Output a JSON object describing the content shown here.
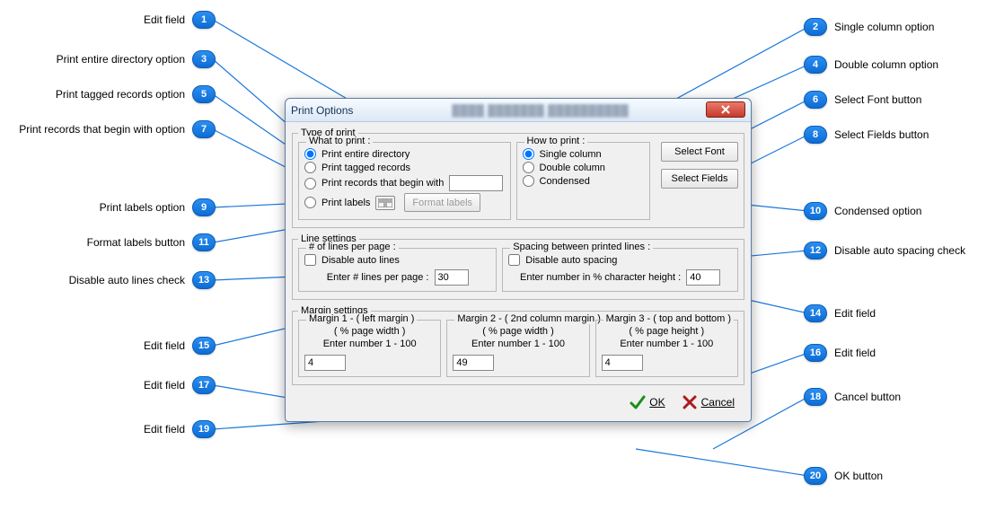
{
  "dialog": {
    "title": "Print Options",
    "blurred_subtitle": "████ ███████ ██████████",
    "type_of_print": {
      "legend": "Type of print",
      "what": {
        "legend": "What to print :",
        "r1": "Print entire directory",
        "r2": "Print tagged records",
        "r3": "Print records that begin with",
        "r3_value": "",
        "r4": "Print labels",
        "format_labels": "Format labels"
      },
      "how": {
        "legend": "How to print :",
        "r1": "Single column",
        "r2": "Double column",
        "r3": "Condensed"
      },
      "buttons": {
        "select_font": "Select Font",
        "select_fields": "Select Fields"
      }
    },
    "line_settings": {
      "legend": "Line settings",
      "lines_per_page": {
        "legend": "# of lines per page :",
        "disable": "Disable auto lines",
        "enter_label": "Enter # lines per page :",
        "value": "30"
      },
      "spacing": {
        "legend": "Spacing between printed lines :",
        "disable": "Disable auto spacing",
        "enter_label": "Enter number in % character height :",
        "value": "40"
      }
    },
    "margin_settings": {
      "legend": "Margin settings",
      "m1_title": "Margin 1 - ( left margin )",
      "m1_sub": "( % page width )",
      "m2_title": "Margin 2 - ( 2nd column margin )",
      "m2_sub": "( % page width )",
      "m3_title": "Margin 3 - ( top and bottom )",
      "m3_sub": "( % page height )",
      "range_label": "Enter number 1 - 100",
      "m1_value": "4",
      "m2_value": "49",
      "m3_value": "4"
    },
    "ok_label": "OK",
    "cancel_label": "Cancel"
  },
  "callouts": {
    "c1": "Edit field",
    "c2": "Single column option",
    "c3": "Print entire directory option",
    "c4": "Double column option",
    "c5": "Print tagged records option",
    "c6": "Select Font button",
    "c7": "Print records that begin with option",
    "c8": "Select Fields button",
    "c9": "Print labels option",
    "c10": "Condensed option",
    "c11": "Format labels button",
    "c12": "Disable auto spacing check",
    "c13": "Disable auto lines check",
    "c14": "Edit field",
    "c15": "Edit field",
    "c16": "Edit field",
    "c17": "Edit field",
    "c18": "Cancel button",
    "c19": "Edit field",
    "c20": "OK button"
  }
}
